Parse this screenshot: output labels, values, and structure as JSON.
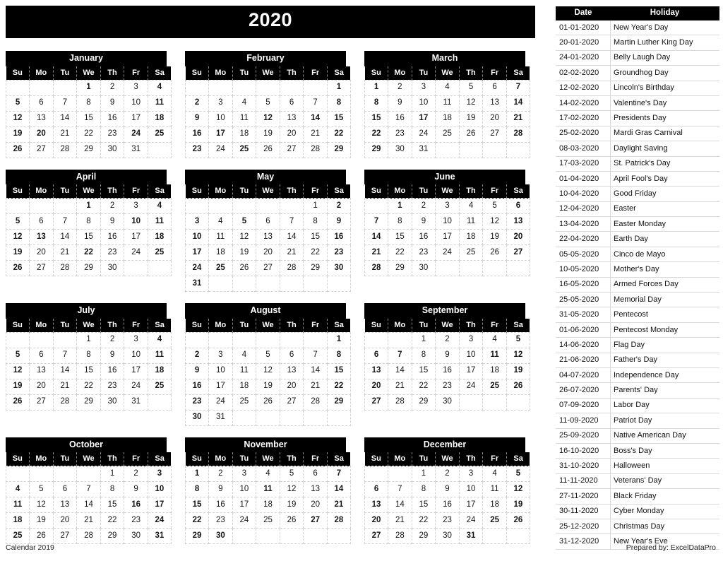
{
  "header": {
    "year": "2020"
  },
  "weekday_headers": [
    "Su",
    "Mo",
    "Tu",
    "We",
    "Th",
    "Fr",
    "Sa"
  ],
  "months": [
    {
      "name": "January",
      "first_weekday": 3,
      "days": 31,
      "holidays": [
        1,
        20,
        24
      ],
      "band_rows": [
        1,
        2,
        3,
        4
      ]
    },
    {
      "name": "February",
      "first_weekday": 6,
      "days": 29,
      "holidays": [
        12,
        14,
        17,
        25
      ],
      "band_rows": [
        1,
        2,
        3,
        4
      ]
    },
    {
      "name": "March",
      "first_weekday": 0,
      "days": 31,
      "holidays": [
        17
      ],
      "band_rows": [
        1,
        2,
        3
      ]
    },
    {
      "name": "April",
      "first_weekday": 3,
      "days": 30,
      "holidays": [
        1,
        10,
        13,
        22
      ],
      "band_rows": [
        1,
        2,
        3
      ]
    },
    {
      "name": "May",
      "first_weekday": 5,
      "days": 31,
      "holidays": [
        5,
        25
      ],
      "band_rows": [
        1,
        2,
        3,
        4
      ]
    },
    {
      "name": "June",
      "first_weekday": 1,
      "days": 30,
      "holidays": [
        1
      ],
      "band_rows": [
        1,
        2,
        3
      ]
    },
    {
      "name": "July",
      "first_weekday": 3,
      "days": 31,
      "holidays": [],
      "band_rows": [
        1,
        2,
        3
      ]
    },
    {
      "name": "August",
      "first_weekday": 6,
      "days": 31,
      "holidays": [],
      "band_rows": [
        1,
        2,
        3,
        4
      ]
    },
    {
      "name": "September",
      "first_weekday": 2,
      "days": 30,
      "holidays": [
        7,
        11,
        25
      ],
      "band_rows": [
        1,
        2,
        3
      ]
    },
    {
      "name": "October",
      "first_weekday": 4,
      "days": 31,
      "holidays": [
        16
      ],
      "band_rows": [
        1,
        2,
        3,
        4
      ]
    },
    {
      "name": "November",
      "first_weekday": 0,
      "days": 30,
      "holidays": [
        11,
        27,
        30
      ],
      "band_rows": [
        1,
        2,
        3
      ]
    },
    {
      "name": "December",
      "first_weekday": 2,
      "days": 31,
      "holidays": [
        25,
        31
      ],
      "band_rows": [
        1,
        2,
        3
      ]
    }
  ],
  "holiday_table": {
    "columns": [
      "Date",
      "Holiday"
    ],
    "rows": [
      [
        "01-01-2020",
        "New Year's Day"
      ],
      [
        "20-01-2020",
        "Martin Luther King Day"
      ],
      [
        "24-01-2020",
        "Belly Laugh Day"
      ],
      [
        "02-02-2020",
        "Groundhog Day"
      ],
      [
        "12-02-2020",
        "Lincoln's Birthday"
      ],
      [
        "14-02-2020",
        "Valentine's Day"
      ],
      [
        "17-02-2020",
        "Presidents Day"
      ],
      [
        "25-02-2020",
        "Mardi Gras Carnival"
      ],
      [
        "08-03-2020",
        "Daylight Saving"
      ],
      [
        "17-03-2020",
        "St. Patrick's Day"
      ],
      [
        "01-04-2020",
        "April Fool's Day"
      ],
      [
        "10-04-2020",
        "Good Friday"
      ],
      [
        "12-04-2020",
        "Easter"
      ],
      [
        "13-04-2020",
        "Easter Monday"
      ],
      [
        "22-04-2020",
        "Earth Day"
      ],
      [
        "05-05-2020",
        "Cinco de Mayo"
      ],
      [
        "10-05-2020",
        "Mother's Day"
      ],
      [
        "16-05-2020",
        "Armed Forces Day"
      ],
      [
        "25-05-2020",
        "Memorial Day"
      ],
      [
        "31-05-2020",
        "Pentecost"
      ],
      [
        "01-06-2020",
        "Pentecost Monday"
      ],
      [
        "14-06-2020",
        "Flag Day"
      ],
      [
        "21-06-2020",
        "Father's Day"
      ],
      [
        "04-07-2020",
        "Independence Day"
      ],
      [
        "26-07-2020",
        "Parents' Day"
      ],
      [
        "07-09-2020",
        "Labor Day"
      ],
      [
        "11-09-2020",
        "Patriot Day"
      ],
      [
        "25-09-2020",
        "Native American Day"
      ],
      [
        "16-10-2020",
        "Boss's Day"
      ],
      [
        "31-10-2020",
        "Halloween"
      ],
      [
        "11-11-2020",
        "Veterans' Day"
      ],
      [
        "27-11-2020",
        "Black Friday"
      ],
      [
        "30-11-2020",
        "Cyber Monday"
      ],
      [
        "25-12-2020",
        "Christmas Day"
      ],
      [
        "31-12-2020",
        "New Year's Eve"
      ]
    ]
  },
  "footer": {
    "left": "Calendar 2019",
    "right": "Prepared by: ExcelDataPro"
  },
  "colors": {
    "header_background": "#000000",
    "header_text": "#ffffff",
    "weekend_shade": "#d4d4d4",
    "holiday_shade": "#c9c9c9",
    "band_shade": "#f0f0f0",
    "grid_line": "#d2d2d2"
  }
}
